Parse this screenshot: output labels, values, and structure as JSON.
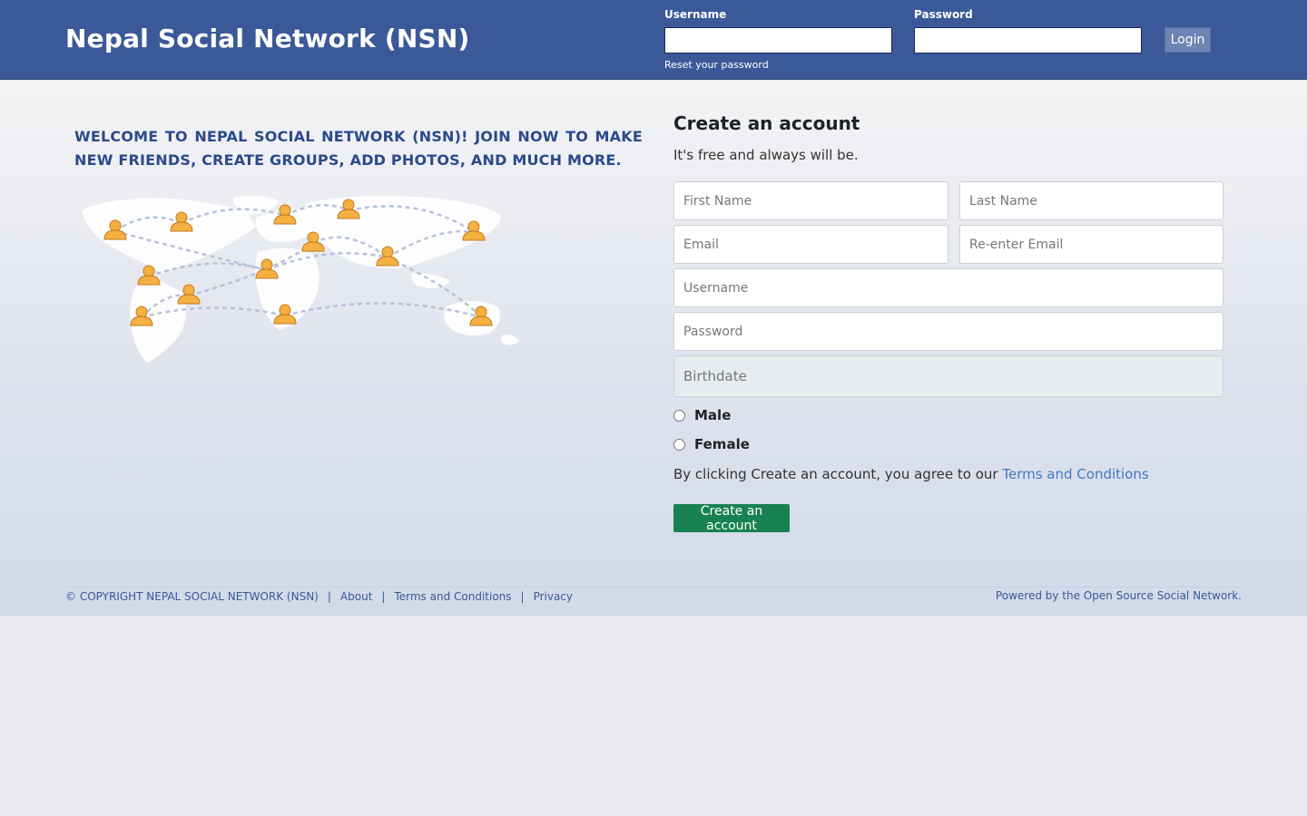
{
  "header": {
    "site_title": "Nepal Social Network (NSN)",
    "username_label": "Username",
    "password_label": "Password",
    "reset_link": "Reset your password",
    "login_button": "Login"
  },
  "welcome": {
    "text": "WELCOME TO NEPAL SOCIAL NETWORK (NSN)! JOIN NOW TO MAKE NEW FRIENDS, CREATE GROUPS, ADD PHOTOS, AND MUCH MORE."
  },
  "signup": {
    "title": "Create an account",
    "subtitle": "It's free and always will be.",
    "first_name_placeholder": "First Name",
    "last_name_placeholder": "Last Name",
    "email_placeholder": "Email",
    "reenter_email_placeholder": "Re-enter Email",
    "username_placeholder": "Username",
    "password_placeholder": "Password",
    "birthdate_placeholder": "Birthdate",
    "gender_male": "Male",
    "gender_female": "Female",
    "agree_prefix": "By clicking Create an account, you agree to our",
    "terms_link": "Terms and Conditions",
    "create_button": "Create an account"
  },
  "footer": {
    "copyright": "© COPYRIGHT NEPAL SOCIAL NETWORK (NSN)",
    "separator": "|",
    "links": [
      "About",
      "Terms and Conditions",
      "Privacy"
    ],
    "powered_by": "Powered by the Open Source Social Network."
  },
  "colors": {
    "header_bg": "#3b5998",
    "accent_blue": "#2c4a8a",
    "create_button": "#188152",
    "link_blue": "#3f7bbf",
    "person_icon": "#f0a93a"
  }
}
